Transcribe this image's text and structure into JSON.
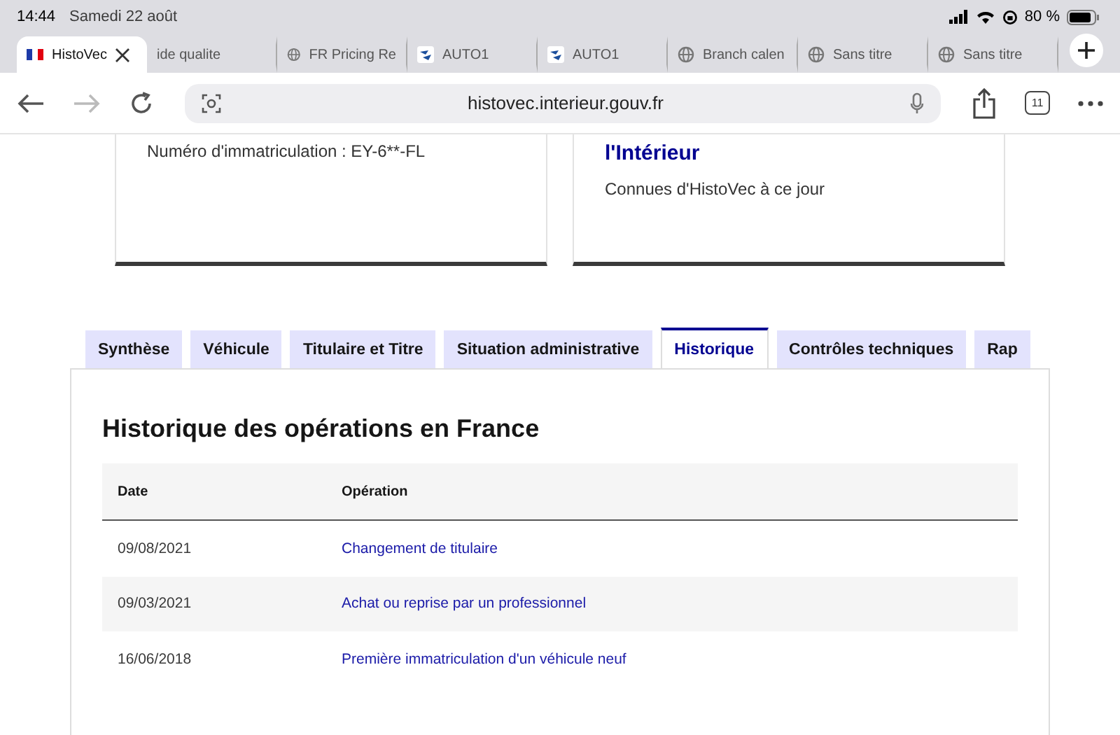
{
  "status_bar": {
    "time": "14:44",
    "date": "Samedi 22 août",
    "battery": "80 %"
  },
  "browser_tabs": [
    {
      "title": "HistoVec",
      "kind": "flag",
      "selected": true
    },
    {
      "title": "ide qualite",
      "kind": "plain",
      "selected": false
    },
    {
      "title": "FR Pricing Re",
      "kind": "globe",
      "selected": false
    },
    {
      "title": "AUTO1",
      "kind": "auto",
      "selected": false
    },
    {
      "title": "AUTO1",
      "kind": "auto",
      "selected": false
    },
    {
      "title": "Branch calen",
      "kind": "globe",
      "selected": false
    },
    {
      "title": "Sans titre",
      "kind": "globe",
      "selected": false
    },
    {
      "title": "Sans titre",
      "kind": "globe",
      "selected": false
    }
  ],
  "toolbar": {
    "url": "histovec.interieur.gouv.fr",
    "tab_count": "11"
  },
  "cards": [
    {
      "text": "Numéro d'immatriculation : EY-6**-FL"
    },
    {
      "title": "l'Intérieur",
      "text": "Connues d'HistoVec à ce jour"
    }
  ],
  "tabs": [
    {
      "label": "Synthèse",
      "selected": false
    },
    {
      "label": "Véhicule",
      "selected": false
    },
    {
      "label": "Titulaire et Titre",
      "selected": false
    },
    {
      "label": "Situation administrative",
      "selected": false
    },
    {
      "label": "Historique",
      "selected": true
    },
    {
      "label": "Contrôles techniques",
      "selected": false
    },
    {
      "label": "Rap",
      "selected": false
    }
  ],
  "section": {
    "heading": "Historique des opérations en France",
    "table": {
      "columns": [
        "Date",
        "Opération"
      ],
      "rows": [
        {
          "date": "09/08/2021",
          "operation": "Changement de titulaire"
        },
        {
          "date": "09/03/2021",
          "operation": "Achat ou reprise par un professionnel"
        },
        {
          "date": "16/06/2018",
          "operation": "Première immatriculation d'un véhicule neuf"
        }
      ]
    }
  }
}
